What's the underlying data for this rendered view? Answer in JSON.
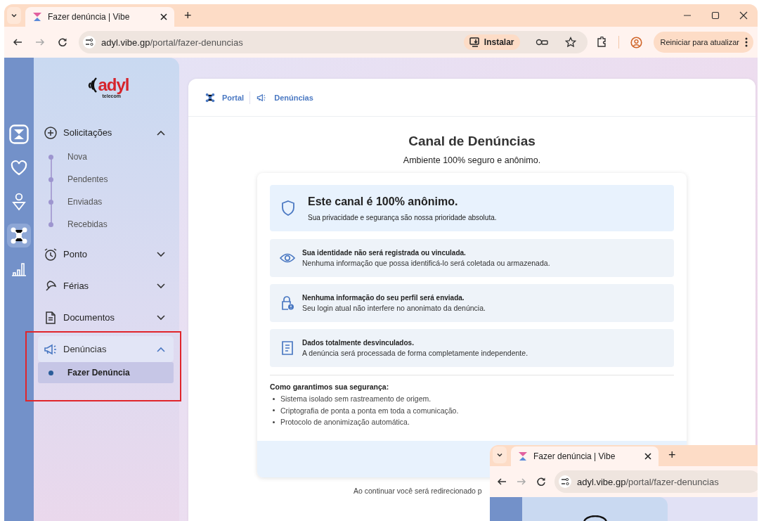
{
  "browser": {
    "tabs": [
      {
        "title": "Fazer denúncia | Vibe",
        "selected": true
      }
    ],
    "new_tab": "+",
    "url_host": "adyl.vibe.gp",
    "url_path": "/portal/fazer-denuncias",
    "install": "Instalar",
    "update": "Reiniciar para atualizar"
  },
  "rail": [
    {
      "kind": "hourglass",
      "selected": false
    },
    {
      "kind": "heart",
      "selected": false
    },
    {
      "kind": "person",
      "selected": false
    },
    {
      "kind": "network",
      "selected": true
    },
    {
      "kind": "chart",
      "selected": false
    }
  ],
  "logo": {
    "name": "adyl",
    "tagline": "telecom"
  },
  "menu": [
    {
      "label": "Solicitações",
      "kind": "plus",
      "expanded": true,
      "selected": false,
      "outlined": false,
      "children": [
        {
          "label": "Nova",
          "selected": false
        },
        {
          "label": "Pendentes",
          "selected": false
        },
        {
          "label": "Enviadas",
          "selected": false
        },
        {
          "label": "Recebidas",
          "selected": false
        }
      ]
    },
    {
      "label": "Ponto",
      "kind": "alarm",
      "expanded": false,
      "selected": false,
      "outlined": false
    },
    {
      "label": "Férias",
      "kind": "umbrella",
      "expanded": false,
      "selected": false,
      "outlined": false
    },
    {
      "label": "Documentos",
      "kind": "document",
      "expanded": false,
      "selected": false,
      "outlined": false
    },
    {
      "label": "Denúncias",
      "kind": "megaphone",
      "expanded": true,
      "selected": true,
      "outlined": true,
      "children": [
        {
          "label": "Fazer Denúncia",
          "selected": true
        }
      ]
    }
  ],
  "breadcrumb": [
    {
      "label": "Portal",
      "kind": "network"
    },
    {
      "label": "Denúncias",
      "kind": "megaphone"
    }
  ],
  "title": "Canal de Denúncias",
  "subtitle": "Ambiente 100% seguro e anônimo.",
  "hero": {
    "title": "Este canal é 100% anônimo.",
    "text": "Sua privacidade e segurança são nossa prioridade absoluta."
  },
  "features": [
    {
      "kind": "eye",
      "title": "Sua identidade não será registrada ou vinculada.",
      "text": "Nenhuma informação que possa identificá-lo será coletada ou armazenada."
    },
    {
      "kind": "lock",
      "title": "Nenhuma informação do seu perfil será enviada.",
      "text": "Seu login atual não interfere no anonimato da denúncia."
    },
    {
      "kind": "document",
      "title": "Dados totalmente desvinculados.",
      "text": "A denúncia será processada de forma completamente independente."
    }
  ],
  "security": {
    "heading": "Como garantimos sua segurança:",
    "items": [
      "Sistema isolado sem rastreamento de origem.",
      "Criptografia de ponta a ponta em toda a comunicação.",
      "Protocolo de anonimização automática."
    ]
  },
  "footer_note": "Ao continuar você será redirecionado p",
  "overlay": {
    "tab_title": "Fazer denúncia | Vibe",
    "new_tab": "+",
    "url_host": "adyl.vibe.gp",
    "url_path": "/portal/fazer-denuncias"
  }
}
